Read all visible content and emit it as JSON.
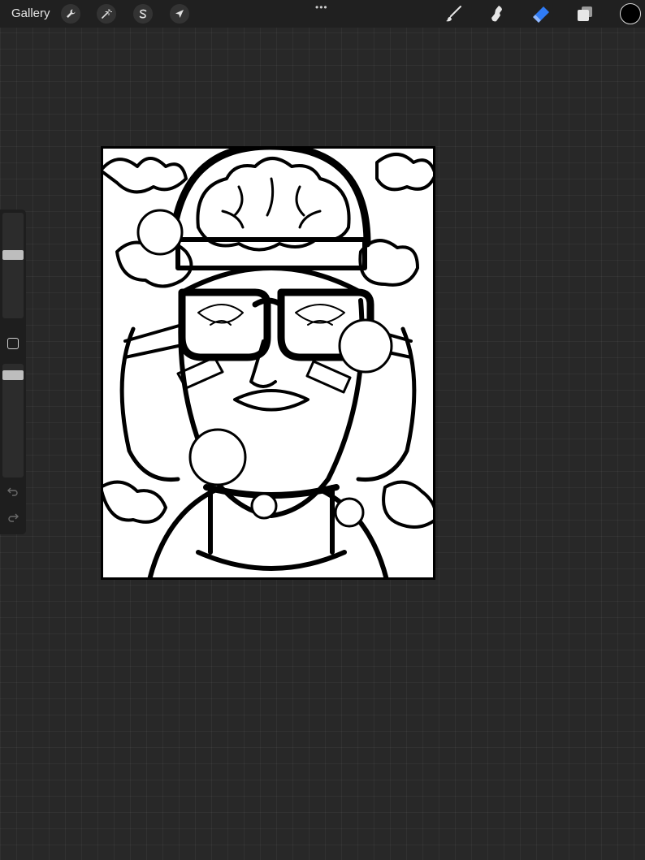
{
  "toolbar": {
    "gallery_label": "Gallery",
    "left_tools": [
      {
        "name": "actions",
        "icon": "wrench-icon"
      },
      {
        "name": "adjustments",
        "icon": "magic-wand-icon"
      },
      {
        "name": "selection",
        "icon": "selection-s-icon"
      },
      {
        "name": "transform",
        "icon": "arrow-cursor-icon"
      }
    ],
    "more_label": "•••",
    "right_tools": [
      {
        "name": "brush",
        "icon": "brush-icon",
        "active": false
      },
      {
        "name": "smudge",
        "icon": "smudge-icon",
        "active": false
      },
      {
        "name": "eraser",
        "icon": "eraser-icon",
        "active": true
      },
      {
        "name": "layers",
        "icon": "layers-icon",
        "active": false
      }
    ],
    "active_color": "#000000",
    "accent_color": "#2f7bf5"
  },
  "sidebar": {
    "brush_size_level": 0.35,
    "opacity_level": 0.1,
    "undo_icon": "undo-icon",
    "redo_icon": "redo-icon"
  },
  "canvas": {
    "artwork": "line-art-illustration",
    "background": "#ffffff"
  }
}
